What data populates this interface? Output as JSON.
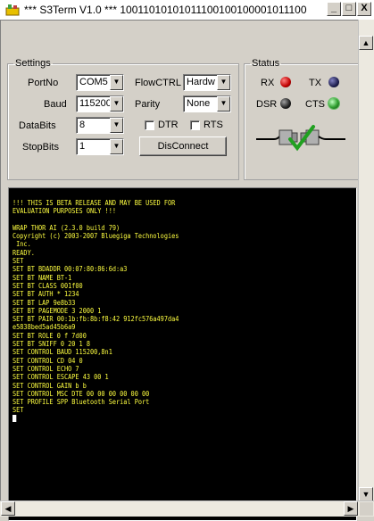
{
  "window": {
    "title": "*** S3Term V1.0 ***   10011010101011100100100001011100 11...",
    "min_label": "_",
    "max_label": "□",
    "close_label": "X"
  },
  "settings": {
    "legend": "Settings",
    "portno_label": "PortNo",
    "portno_value": "COM5",
    "flowctrl_label": "FlowCTRL",
    "flowctrl_value": "Hardw",
    "baud_label": "Baud",
    "baud_value": "115200",
    "parity_label": "Parity",
    "parity_value": "None",
    "databits_label": "DataBits",
    "databits_value": "8",
    "dtr_label": "DTR",
    "rts_label": "RTS",
    "stopbits_label": "StopBits",
    "stopbits_value": "1",
    "disconnect_label": "DisConnect"
  },
  "status": {
    "legend": "Status",
    "rx_label": "RX",
    "tx_label": "TX",
    "dsr_label": "DSR",
    "cts_label": "CTS",
    "colors": {
      "rx": "#c00000",
      "tx": "#202050",
      "dsr": "#202020",
      "cts": "#30a030"
    }
  },
  "terminal": {
    "text_color": "#ffff40",
    "lines": [
      "!!! THIS IS BETA RELEASE AND MAY BE USED FOR",
      "EVALUATION PURPOSES ONLY !!!",
      "",
      "WRAP THOR AI (2.3.0 build 79)",
      "Copyright (c) 2003-2007 Bluegiga Technologies",
      " Inc.",
      "READY.",
      "SET",
      "SET BT BDADDR 00:07:80:86:6d:a3",
      "SET BT NAME BT-1",
      "SET BT CLASS 001f00",
      "SET BT AUTH * 1234",
      "SET BT LAP 9e8b33",
      "SET BT PAGEMODE 3 2000 1",
      "SET BT PAIR 00:1b:fb:8b:f8:42 912fc576a497da4",
      "e5838bed5ad45b6a9",
      "SET BT ROLE 0 f 7d00",
      "SET BT SNIFF 0 20 1 8",
      "SET CONTROL BAUD 115200,8n1",
      "SET CONTROL CD 04 0",
      "SET CONTROL ECHO 7",
      "SET CONTROL ESCAPE 43 00 1",
      "SET CONTROL GAIN b b",
      "SET CONTROL MSC DTE 00 00 00 00 00 00",
      "SET PROFILE SPP Bluetooth Serial Port",
      "SET"
    ]
  }
}
